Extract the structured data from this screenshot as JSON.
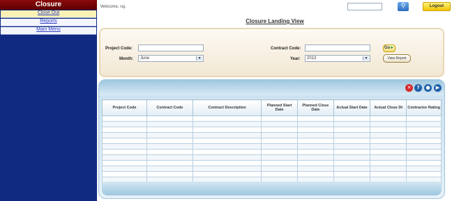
{
  "sidebar": {
    "title": "Closure",
    "items": [
      {
        "label": "Close Out"
      },
      {
        "label": "Reports"
      },
      {
        "label": "Main Menu"
      }
    ]
  },
  "topbar": {
    "welcome": "Welcome, raj.",
    "logout_label": "Logout",
    "search_icon": "search-icon"
  },
  "page": {
    "title": "Closure Landing View"
  },
  "filters": {
    "project_code_label": "Project Code:",
    "project_code_value": "",
    "contract_code_label": "Contract Code:",
    "contract_code_value": "",
    "month_label": "Month:",
    "month_value": "June",
    "year_label": "Year:",
    "year_value": "2013",
    "go_label": "Go",
    "view_report_label": "View Report"
  },
  "grid": {
    "toolbar_icons": [
      "delete-icon",
      "help-icon",
      "record-icon",
      "forward-icon"
    ],
    "columns": [
      "Project Code",
      "Contract Code",
      "Contract Description",
      "Planned Start Date",
      "Planned Close Date",
      "Actual Start Date",
      "Actual Close Dt",
      "Contractor Rating"
    ],
    "row_count": 13
  },
  "colors": {
    "sidebar_bg": "#0f2a80",
    "sidebar_title_bg": "#8a0a0a",
    "logout_bg": "#f0c400",
    "panel_border": "#ead7b6",
    "grid_accent": "#9ec7e0"
  }
}
